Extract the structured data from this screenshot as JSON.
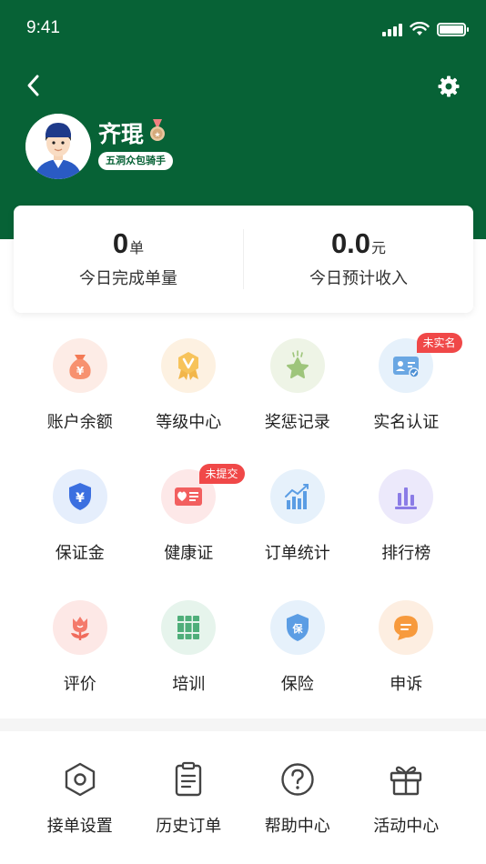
{
  "status_bar": {
    "time": "9:41"
  },
  "profile": {
    "name": "齐琨",
    "role_tag": "五洞众包骑手"
  },
  "stats": [
    {
      "value": "0",
      "unit": "单",
      "label": "今日完成单量"
    },
    {
      "value": "0.0",
      "unit": "元",
      "label": "今日预计收入"
    }
  ],
  "grid": [
    {
      "label": "账户余额",
      "icon": "money-bag-icon"
    },
    {
      "label": "等级中心",
      "icon": "level-badge-icon"
    },
    {
      "label": "奖惩记录",
      "icon": "star-icon"
    },
    {
      "label": "实名认证",
      "icon": "id-card-icon",
      "badge": "未实名"
    },
    {
      "label": "保证金",
      "icon": "deposit-shield-icon"
    },
    {
      "label": "健康证",
      "icon": "health-cert-icon",
      "badge": "未提交"
    },
    {
      "label": "订单统计",
      "icon": "bar-chart-icon"
    },
    {
      "label": "排行榜",
      "icon": "ranking-icon"
    },
    {
      "label": "评价",
      "icon": "flower-icon"
    },
    {
      "label": "培训",
      "icon": "books-icon"
    },
    {
      "label": "保险",
      "icon": "insurance-shield-icon"
    },
    {
      "label": "申诉",
      "icon": "chat-bubble-icon"
    }
  ],
  "bottom": [
    {
      "label": "接单设置",
      "icon": "hex-nut-icon"
    },
    {
      "label": "历史订单",
      "icon": "clipboard-icon"
    },
    {
      "label": "帮助中心",
      "icon": "question-icon"
    },
    {
      "label": "活动中心",
      "icon": "gift-icon"
    }
  ],
  "colors": {
    "primary": "#076236",
    "badge": "#f04848"
  }
}
